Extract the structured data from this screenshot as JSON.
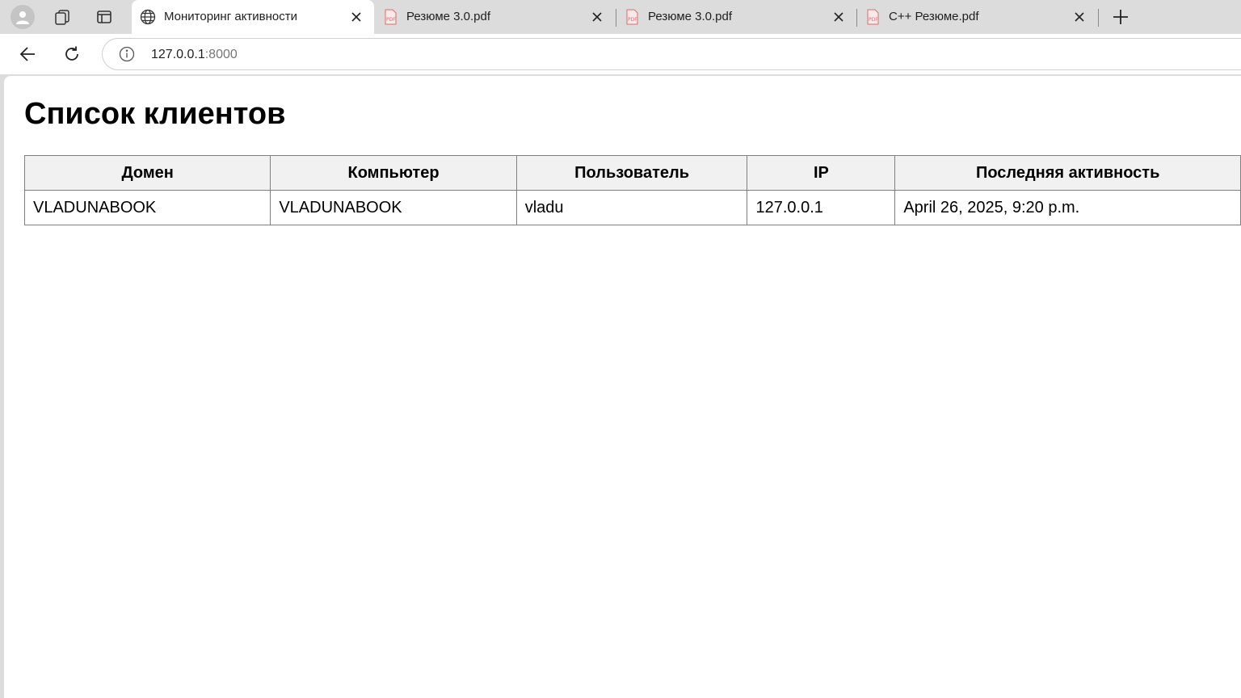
{
  "browser": {
    "tabs": [
      {
        "title": "Мониторинг активности",
        "active": true,
        "icon": "globe-icon"
      },
      {
        "title": "Резюме 3.0.pdf",
        "active": false,
        "icon": "pdf-icon"
      },
      {
        "title": "Резюме 3.0.pdf",
        "active": false,
        "icon": "pdf-icon"
      },
      {
        "title": "C++ Резюме.pdf",
        "active": false,
        "icon": "pdf-icon"
      }
    ],
    "address": {
      "host": "127.0.0.1",
      "port": ":8000"
    }
  },
  "page": {
    "heading": "Список клиентов",
    "table": {
      "headers": [
        "Домен",
        "Компьютер",
        "Пользователь",
        "IP",
        "Последняя активность"
      ],
      "rows": [
        [
          "VLADUNABOOK",
          "VLADUNABOOK",
          "vladu",
          "127.0.0.1",
          "April 26, 2025, 9:20 p.m."
        ]
      ]
    }
  },
  "colors": {
    "tabstrip_bg": "#dcdcdc",
    "header_bg": "#f1f1f1",
    "border": "#808080",
    "pdf_red": "#e06a6a"
  }
}
